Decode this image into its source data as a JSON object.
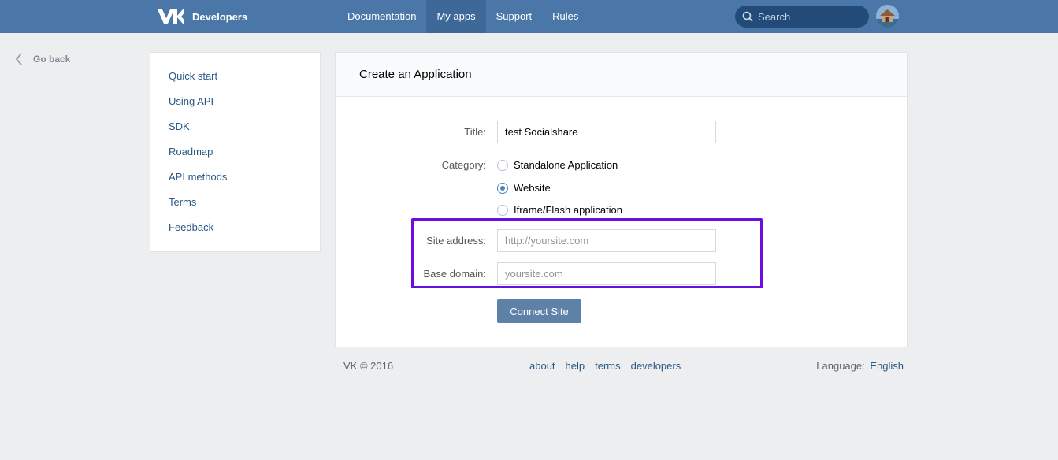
{
  "header": {
    "brand": "Developers",
    "nav": [
      {
        "label": "Documentation",
        "active": false
      },
      {
        "label": "My apps",
        "active": true
      },
      {
        "label": "Support",
        "active": false
      },
      {
        "label": "Rules",
        "active": false
      }
    ],
    "search_placeholder": "Search",
    "icons": {
      "logo": "vk-logo-icon",
      "search": "search-icon",
      "avatar": "user-avatar"
    }
  },
  "goback": {
    "label": "Go back",
    "icon": "chevron-left-icon"
  },
  "sidebar": {
    "items": [
      {
        "label": "Quick start"
      },
      {
        "label": "Using API"
      },
      {
        "label": "SDK"
      },
      {
        "label": "Roadmap"
      },
      {
        "label": "API methods"
      },
      {
        "label": "Terms"
      },
      {
        "label": "Feedback"
      }
    ]
  },
  "form": {
    "heading": "Create an Application",
    "title_label": "Title:",
    "title_value": "test Socialshare",
    "category_label": "Category:",
    "categories": [
      {
        "label": "Standalone Application",
        "checked": false
      },
      {
        "label": "Website",
        "checked": true
      },
      {
        "label": "Iframe/Flash application",
        "checked": false
      }
    ],
    "site_address_label": "Site address:",
    "site_address_placeholder": "http://yoursite.com",
    "base_domain_label": "Base domain:",
    "base_domain_placeholder": "yoursite.com",
    "submit_label": "Connect Site",
    "highlight_color": "#6a0ee0"
  },
  "footer": {
    "copyright": "VK © 2016",
    "links": [
      "about",
      "help",
      "terms",
      "developers"
    ],
    "language_label": "Language:",
    "language_value": "English"
  },
  "colors": {
    "header_bg": "#4a76a8",
    "page_bg": "#edeef0",
    "link": "#2a5885",
    "button": "#5e81a8"
  }
}
